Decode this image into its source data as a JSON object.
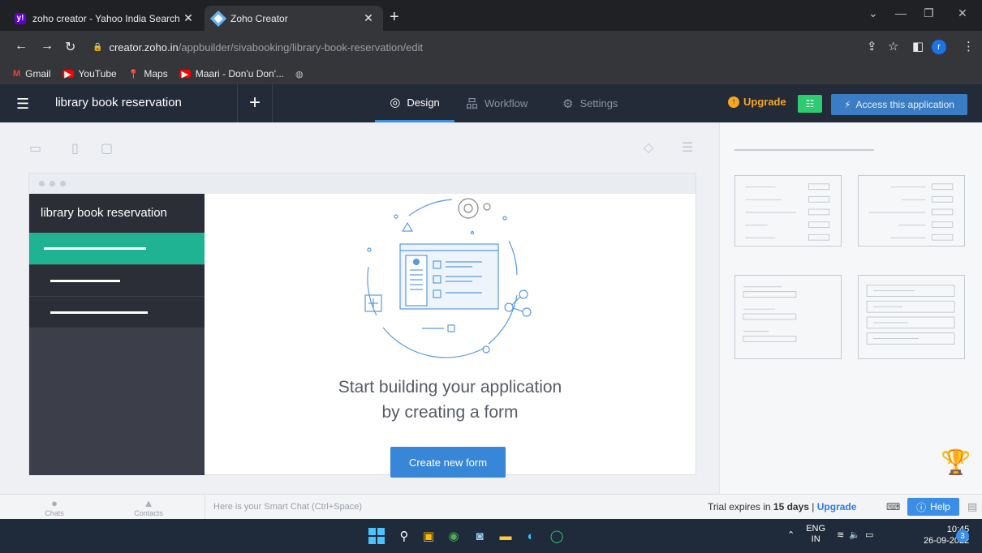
{
  "browser": {
    "tabs": [
      {
        "label": "zoho creator - Yahoo India Search",
        "favicon": "yahoo-icon"
      },
      {
        "label": "Zoho Creator",
        "favicon": "zoho-icon"
      }
    ],
    "url_host": "creator.zoho.in",
    "url_path": "/appbuilder/sivabooking/library-book-reservation/edit",
    "profile_initial": "r",
    "bookmarks": [
      "Gmail",
      "YouTube",
      "Maps",
      "Maari - Don'u Don'..."
    ]
  },
  "header": {
    "app_name": "library book reservation",
    "tabs": [
      "Design",
      "Workflow",
      "Settings"
    ],
    "upgrade_label": "Upgrade",
    "access_label": "Access this application"
  },
  "preview": {
    "app_name": "library book reservation",
    "empty_line1": "Start building your application",
    "empty_line2": "by creating a form",
    "create_button": "Create new form"
  },
  "chatbar": {
    "chats_label": "Chats",
    "contacts_label": "Contacts",
    "input_placeholder": "Here is your Smart Chat (Ctrl+Space)",
    "trial_prefix": "Trial expires in ",
    "trial_days": "15 days",
    "trial_sep": " | ",
    "trial_upgrade": "Upgrade",
    "help_label": "Help"
  },
  "taskbar": {
    "lang1": "ENG",
    "lang2": "IN",
    "time": "10:45",
    "date": "26-09-2022",
    "notification_count": "3"
  },
  "colors": {
    "accent": "#3786d8",
    "header_bg": "#232a38",
    "selected_item": "#1fb394",
    "upgrade": "#f5a623"
  }
}
